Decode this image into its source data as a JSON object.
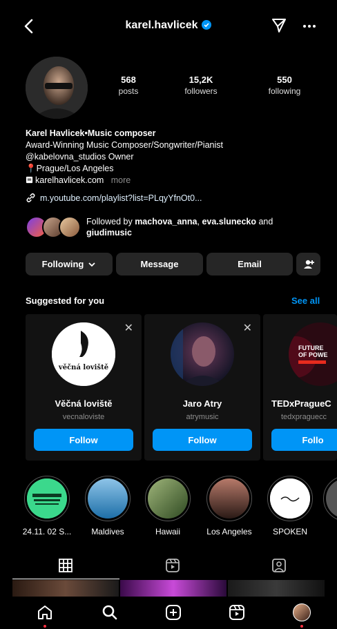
{
  "header": {
    "username": "karel.havlicek",
    "icons": [
      "back-arrow-icon",
      "verified-badge-icon",
      "direct-message-icon",
      "more-icon"
    ]
  },
  "profile": {
    "stats": [
      {
        "value": "568",
        "label": "posts"
      },
      {
        "value": "15,2K",
        "label": "followers"
      },
      {
        "value": "550",
        "label": "following"
      }
    ],
    "bio": {
      "name": "Karel Havlicek•Music composer",
      "line1": "Award-Winning Music Composer/Songwriter/Pianist",
      "line2": "@kabelovna_studios Owner",
      "line3": "📍Prague/Los Angeles",
      "line4": "karelhavlicek.com",
      "more": "more"
    },
    "link": "m.youtube.com/playlist?list=PLqyYfnOt0...",
    "followed_by": {
      "prefix": "Followed by ",
      "user1": "machova_anna",
      "sep": ", ",
      "user2": "eva.slunecko",
      "and": " and",
      "user3": "giudimusic"
    }
  },
  "actions": {
    "following": "Following",
    "message": "Message",
    "email": "Email"
  },
  "suggested": {
    "title": "Suggested for you",
    "see_all": "See all",
    "cards": [
      {
        "name": "Věčná loviště",
        "username": "vecnaloviste",
        "follow": "Follow",
        "logo_text": "věčná loviště"
      },
      {
        "name": "Jaro Atry",
        "username": "atrymusic",
        "follow": "Follow"
      },
      {
        "name": "TEDxPragueC",
        "username": "tedxpraguecc",
        "follow": "Follo",
        "logo_text1": "FUTURE",
        "logo_text2": "OF POWE"
      }
    ]
  },
  "highlights": [
    {
      "label": "24.11. 02 S..."
    },
    {
      "label": "Maldives"
    },
    {
      "label": "Hawaii"
    },
    {
      "label": "Los Angeles"
    },
    {
      "label": "SPOKEN"
    }
  ],
  "tabs": [
    "grid-icon",
    "reels-icon",
    "tagged-icon"
  ],
  "nav": [
    "home-icon",
    "search-icon",
    "new-post-icon",
    "reels-icon",
    "profile-avatar"
  ],
  "colors": {
    "accent": "#0095f6",
    "button": "#262626",
    "notification": "#ff3040"
  }
}
